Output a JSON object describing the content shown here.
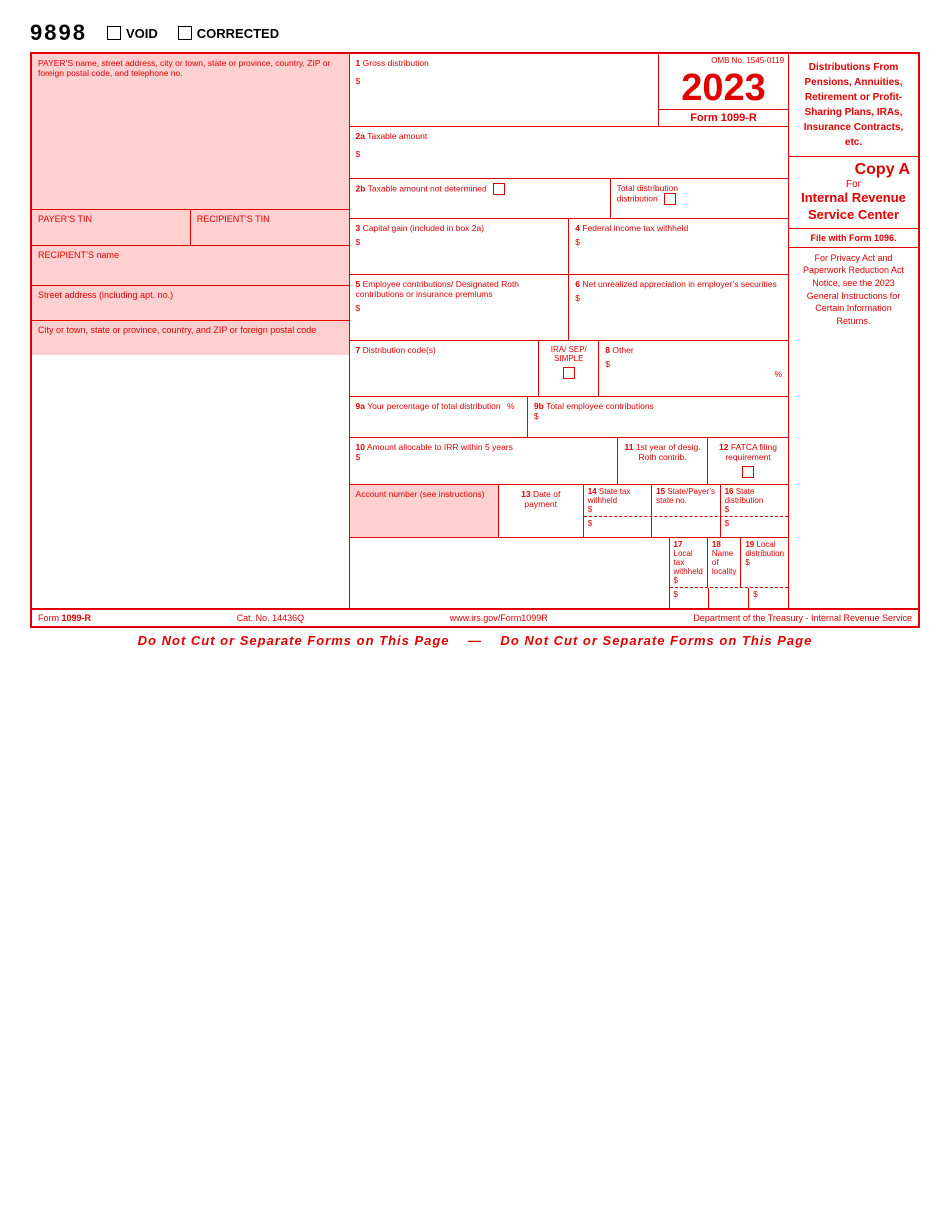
{
  "header": {
    "form_number": "9898",
    "void_label": "VOID",
    "corrected_label": "CORRECTED"
  },
  "form": {
    "title": "Form 1099-R",
    "cat_no": "Cat. No. 14436Q",
    "website": "www.irs.gov/Form1099R",
    "department": "Department of the Treasury - Internal Revenue Service",
    "omb_no": "OMB No. 1545-0119",
    "year": "20",
    "year_bold": "23",
    "copy": "Copy A",
    "for_label": "For",
    "irs_center": "Internal Revenue Service Center",
    "file_with": "File with Form 1096.",
    "privacy_notice": "For Privacy Act and Paperwork Reduction Act Notice, see the 2023 General Instructions for Certain Information Returns.",
    "distribution_title": "Distributions From Pensions, Annuities, Retirement or Profit-Sharing Plans, IRAs, Insurance Contracts, etc.",
    "do_not_cut": "Do Not Cut or Separate Forms on This Page    —    Do Not Cut or Separate Forms on This Page"
  },
  "fields": {
    "payer_info_label": "PAYER’S name, street address, city or town, state or province, country, ZIP or foreign postal code, and telephone no.",
    "payer_tin_label": "PAYER’S TIN",
    "recipient_tin_label": "RECIPIENT’S TIN",
    "recipient_name_label": "RECIPIENT’S name",
    "street_address_label": "Street address (including apt. no.)",
    "city_label": "City or town, state or province, country, and ZIP or foreign postal code",
    "f1_label": "1",
    "f1_name": "Gross distribution",
    "f1_dollar": "$",
    "f2a_label": "2a",
    "f2a_name": "Taxable amount",
    "f2a_dollar": "$",
    "f2b_label": "2b",
    "f2b_name": "Taxable amount not determined",
    "f2b_total_label": "Total distribution",
    "f3_label": "3",
    "f3_name": "Capital gain (included in box 2a)",
    "f3_dollar": "$",
    "f4_label": "4",
    "f4_name": "Federal income tax withheld",
    "f4_dollar": "$",
    "f5_label": "5",
    "f5_name": "Employee contributions/ Designated Roth contributions or insurance premiums",
    "f5_dollar": "$",
    "f6_label": "6",
    "f6_name": "Net unrealized appreciation in employer’s securities",
    "f6_dollar": "$",
    "f7_label": "7",
    "f7_name": "Distribution code(s)",
    "f7_checkbox_ira_sep_simple": "IRA/ SEP/ SIMPLE",
    "f8_label": "8",
    "f8_name": "Other",
    "f8_dollar": "$",
    "f8_pct": "%",
    "f9a_label": "9a",
    "f9a_name": "Your percentage of total distribution",
    "f9a_pct": "%",
    "f9b_label": "9b",
    "f9b_name": "Total employee contributions",
    "f9b_dollar": "$",
    "f10_label": "10",
    "f10_name": "Amount allocable to IRR within 5 years",
    "f10_dollar": "$",
    "f11_label": "11",
    "f11_name": "1st year of desig. Roth contrib.",
    "f12_label": "12",
    "f12_name": "FATCA filing requirement",
    "f13_label": "13",
    "f13_name": "Date of payment",
    "f14_label": "14",
    "f14_name": "State tax withheld",
    "f14_dollar": "$",
    "f15_label": "15",
    "f15_name": "State/Payer’s state no.",
    "f16_label": "16",
    "f16_name": "State distribution",
    "f16_dollar": "$",
    "f17_label": "17",
    "f17_name": "Local tax withheld",
    "f17_dollar1": "$",
    "f17_dollar2": "$",
    "f18_label": "18",
    "f18_name": "Name of locality",
    "f19_label": "19",
    "f19_name": "Local distribution",
    "f19_dollar1": "$",
    "f19_dollar2": "$"
  }
}
